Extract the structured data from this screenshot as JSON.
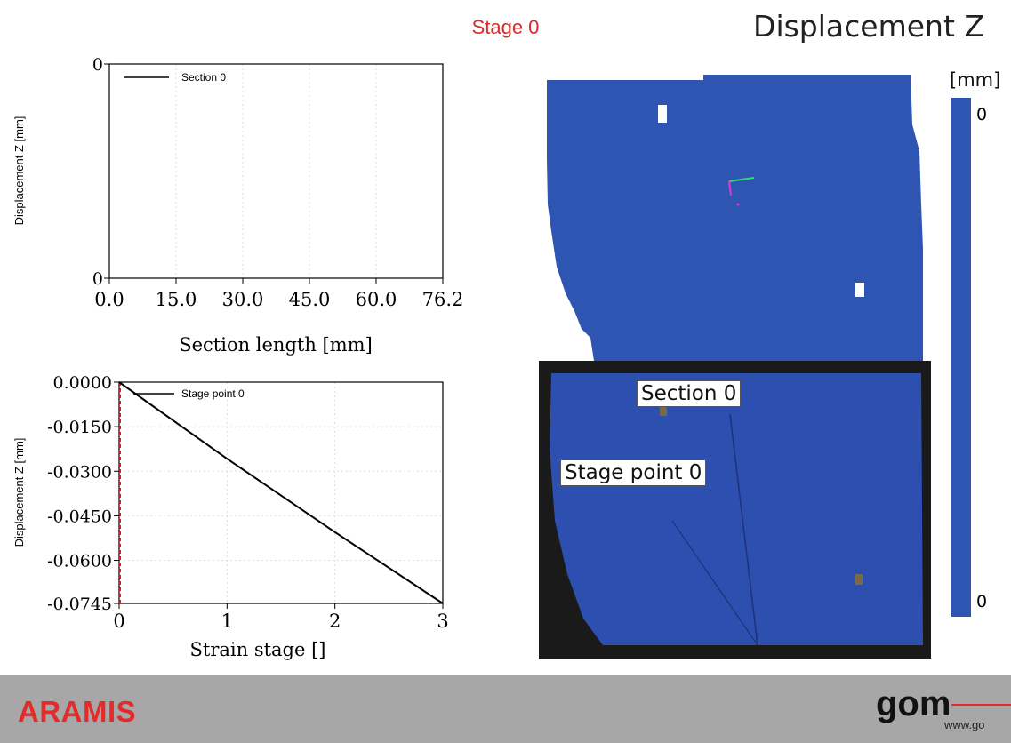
{
  "header": {
    "stage_label": "Stage 0",
    "main_title": "Displacement Z"
  },
  "colorbar": {
    "unit": "[mm]",
    "top_value": "0",
    "bottom_value": "0",
    "color": "#2f55b3"
  },
  "overlay_labels": {
    "section": "Section 0",
    "stage_point": "Stage point 0"
  },
  "footer": {
    "brand": "ARAMIS",
    "logo": "gom",
    "url": "www.go"
  },
  "colors": {
    "accent_red": "#e02828",
    "field_blue": "#2f55b3",
    "footer_gray": "#a7a7a7"
  },
  "chart_data": [
    {
      "type": "line",
      "xlabel": "Section length [mm]",
      "ylabel": "Displacement Z [mm]",
      "x_ticks": [
        "0.0",
        "15.0",
        "30.0",
        "45.0",
        "60.0",
        "76.2"
      ],
      "y_ticks": [
        "0",
        "0"
      ],
      "xlim": [
        0,
        76.2
      ],
      "grid": true,
      "legend_position": "top-left",
      "series": [
        {
          "name": "Section 0",
          "x": [],
          "y": [],
          "color": "#000000"
        }
      ]
    },
    {
      "type": "line",
      "xlabel": "Strain stage []",
      "ylabel": "Displacement Z [mm]",
      "x_ticks": [
        "0",
        "1",
        "2",
        "3"
      ],
      "y_ticks": [
        "0.0000",
        "-0.0150",
        "-0.0300",
        "-0.0450",
        "-0.0600",
        "-0.0745"
      ],
      "xlim": [
        0,
        3
      ],
      "ylim": [
        -0.0745,
        0
      ],
      "grid": true,
      "legend_position": "top-left",
      "series": [
        {
          "name": "Stage point 0",
          "x": [
            0,
            1,
            2,
            3
          ],
          "y": [
            0,
            -0.0258,
            -0.0505,
            -0.0745
          ],
          "color": "#000000"
        }
      ],
      "marker_line": {
        "x": 0,
        "color": "#d02020",
        "style": "dashed"
      }
    }
  ]
}
